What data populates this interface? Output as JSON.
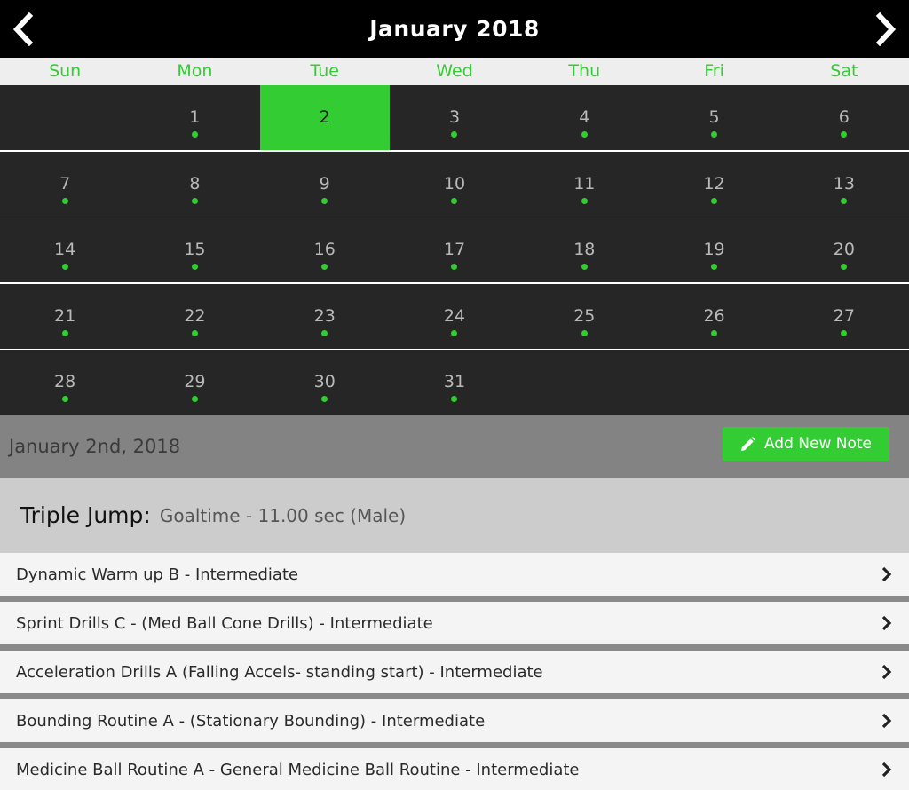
{
  "calendar": {
    "title": "January 2018",
    "weekdays": [
      "Sun",
      "Mon",
      "Tue",
      "Wed",
      "Thu",
      "Fri",
      "Sat"
    ],
    "weeks": [
      [
        "",
        "1",
        "2",
        "3",
        "4",
        "5",
        "6"
      ],
      [
        "7",
        "8",
        "9",
        "10",
        "11",
        "12",
        "13"
      ],
      [
        "14",
        "15",
        "16",
        "17",
        "18",
        "19",
        "20"
      ],
      [
        "21",
        "22",
        "23",
        "24",
        "25",
        "26",
        "27"
      ],
      [
        "28",
        "29",
        "30",
        "31",
        "",
        "",
        ""
      ]
    ],
    "selected_day": "2",
    "event_dot_color": "#33cc33",
    "accent_color": "#33cc33"
  },
  "date_bar": {
    "selected_date": "January 2nd, 2018",
    "add_note_label": "Add New Note",
    "add_note_icon": "pencil-icon"
  },
  "event": {
    "name": "Triple Jump:",
    "goal": "Goaltime - 11.00 sec (Male)"
  },
  "routines": [
    {
      "label": "Dynamic Warm up B - Intermediate"
    },
    {
      "label": "Sprint Drills C - (Med Ball Cone Drills) - Intermediate"
    },
    {
      "label": "Acceleration Drills A (Falling Accels- standing start) - Intermediate"
    },
    {
      "label": "Bounding Routine A - (Stationary Bounding) - Intermediate"
    },
    {
      "label": "Medicine Ball Routine A - General Medicine Ball Routine - Intermediate"
    }
  ]
}
